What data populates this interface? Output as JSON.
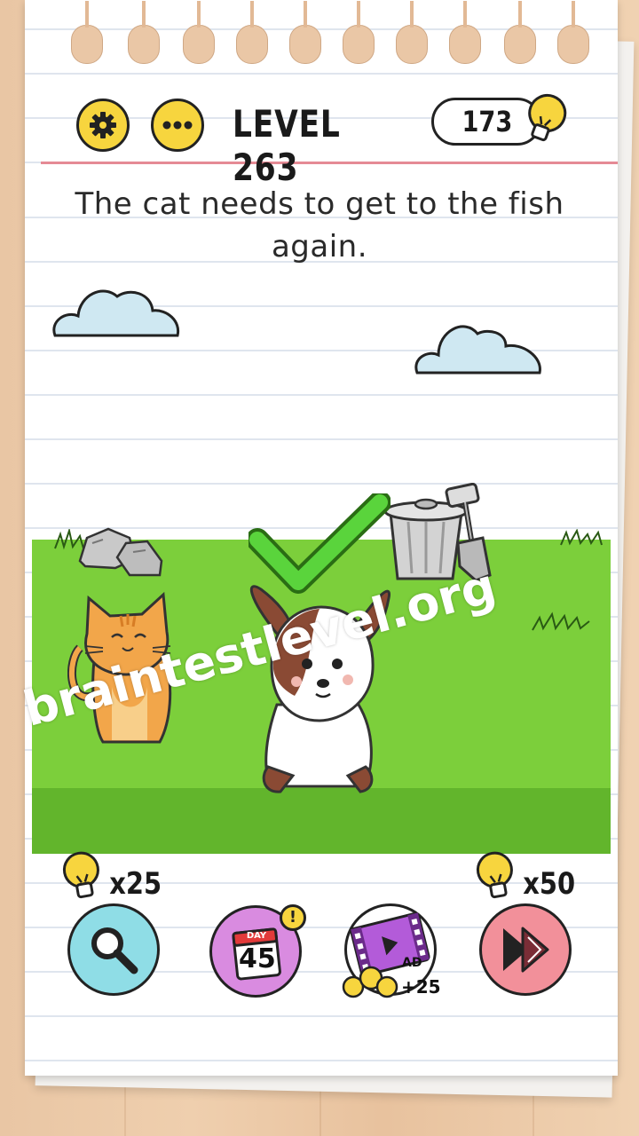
{
  "header": {
    "settings_icon": "gear-icon",
    "menu_icon": "dots-icon",
    "level_title": "LEVEL 263",
    "hint_count": "173",
    "hint_icon": "lightbulb-icon"
  },
  "puzzle": {
    "question": "The cat needs to get to the fish again."
  },
  "watermark": "braintestlevel.org",
  "bottom_bar": {
    "hint_cost": "x25",
    "skip_cost": "x50",
    "daily_top": "DAY",
    "daily_day": "45",
    "daily_badge": "!",
    "ad_label": "AD",
    "ad_reward": "+25"
  },
  "colors": {
    "accent_yellow": "#f7d53e",
    "grass": "#7ccf3b",
    "search_button": "#8fdde6",
    "daily_button": "#d98be0",
    "skip_button": "#f2909a",
    "margin_line": "#e58a95"
  }
}
